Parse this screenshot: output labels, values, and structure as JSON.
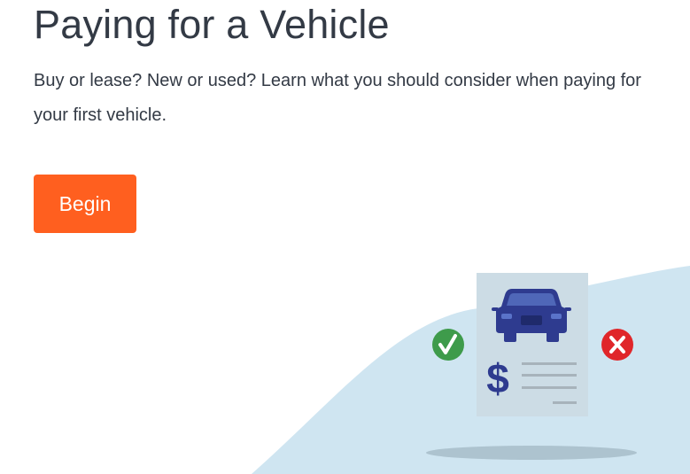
{
  "header": {
    "title": "Paying for a Vehicle",
    "description": "Buy or lease? New or used? Learn what you should consider when paying for your first vehicle."
  },
  "actions": {
    "begin_label": "Begin"
  },
  "illustration": {
    "dollar_symbol": "$",
    "icons": [
      "car-icon",
      "check-circle-icon",
      "x-circle-icon",
      "document-icon"
    ]
  },
  "colors": {
    "accent": "#ff5f1f",
    "text": "#333a45",
    "hill": "#cfe5f1",
    "document": "#ccdce5",
    "car": "#2e3b8f",
    "check": "#3e9b4b",
    "cross": "#e0262a"
  }
}
